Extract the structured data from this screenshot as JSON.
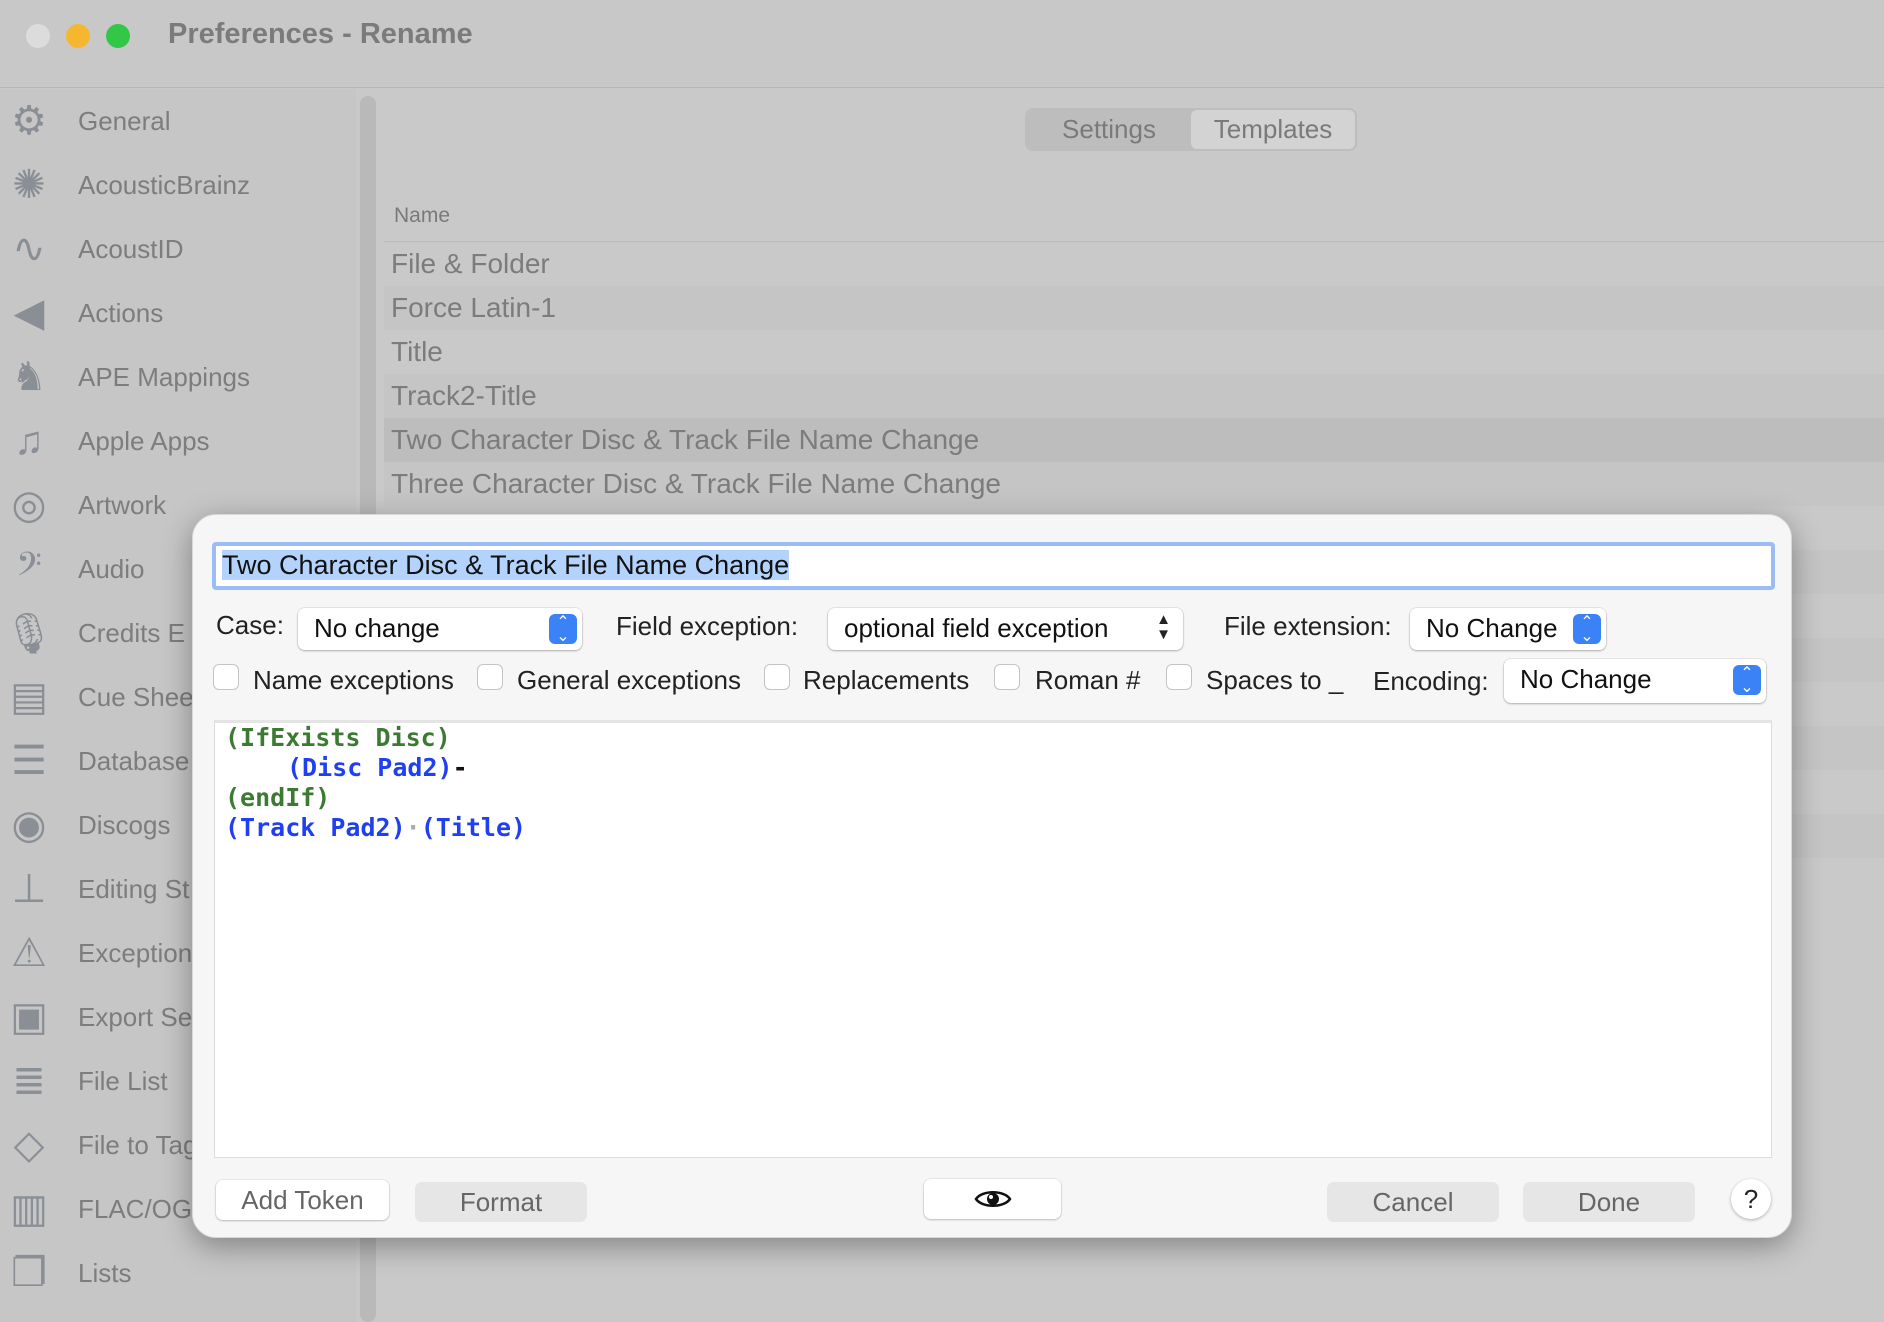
{
  "window": {
    "title": "Preferences - Rename"
  },
  "colors": {
    "close": "#dcdcdc",
    "minimize": "#f5b730",
    "maximize": "#33c748",
    "accent": "#3b82f6",
    "keyword_green": "#3c7a33",
    "token_blue": "#1f3ff0"
  },
  "sidebar": {
    "items": [
      {
        "label": "General",
        "icon": "gear-icon"
      },
      {
        "label": "AcousticBrainz",
        "icon": "brain-icon"
      },
      {
        "label": "AcoustID",
        "icon": "waveform-icon"
      },
      {
        "label": "Actions",
        "icon": "megaphone-icon"
      },
      {
        "label": "APE Mappings",
        "icon": "ape-icon"
      },
      {
        "label": "Apple Apps",
        "icon": "music-note-icon"
      },
      {
        "label": "Artwork",
        "icon": "aperture-icon"
      },
      {
        "label": "Audio",
        "icon": "bass-clef-icon"
      },
      {
        "label": "Credits E",
        "icon": "microphone-icon"
      },
      {
        "label": "Cue Shee",
        "icon": "cue-file-icon"
      },
      {
        "label": "Database",
        "icon": "database-icon"
      },
      {
        "label": "Discogs",
        "icon": "vinyl-icon"
      },
      {
        "label": "Editing St",
        "icon": "stamp-icon"
      },
      {
        "label": "Exception",
        "icon": "warning-icon"
      },
      {
        "label": "Export Se",
        "icon": "archive-icon"
      },
      {
        "label": "File List",
        "icon": "list-icon"
      },
      {
        "label": "File to Tag",
        "icon": "tag-icon"
      },
      {
        "label": "FLAC/OGG",
        "icon": "level-meter-icon"
      },
      {
        "label": "Lists",
        "icon": "lists-icon"
      }
    ]
  },
  "main": {
    "tabs": [
      {
        "label": "Settings"
      },
      {
        "label": "Templates"
      }
    ],
    "column_header": "Name",
    "rows": [
      "File & Folder",
      "Force Latin-1",
      "Title",
      "Track2-Title",
      "Two Character Disc & Track File Name Change",
      "Three Character Disc & Track File Name Change"
    ]
  },
  "dialog": {
    "name_value": "Two Character Disc & Track File Name Change",
    "case_label": "Case:",
    "case_value": "No change",
    "field_exception_label": "Field exception:",
    "field_exception_value": "optional field exception",
    "file_extension_label": "File extension:",
    "file_extension_value": "No Change",
    "checkboxes": [
      {
        "label": "Name exceptions",
        "checked": false
      },
      {
        "label": "General exceptions",
        "checked": false
      },
      {
        "label": "Replacements",
        "checked": false
      },
      {
        "label": "Roman #",
        "checked": false
      },
      {
        "label": "Spaces to _",
        "checked": false
      }
    ],
    "encoding_label": "Encoding:",
    "encoding_value": "No Change",
    "script": {
      "l1": "(IfExists Disc)",
      "l2": "(Disc Pad2)",
      "l2b": "-",
      "l3": "(endIf)",
      "l4a": "(Track Pad2)",
      "l4dot": "·",
      "l4b": "(Title)"
    },
    "add_token": "Add Token",
    "format": "Format",
    "preview_icon": "eye-icon",
    "cancel": "Cancel",
    "done": "Done",
    "help": "?"
  }
}
